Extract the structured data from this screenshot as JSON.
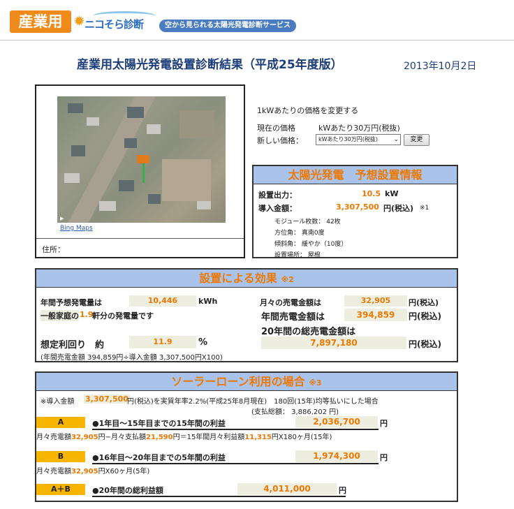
{
  "header": {
    "badge": "産業用",
    "brand_name": "ニコそら診断",
    "tagline": "空から見られる太陽光発電診断サービス"
  },
  "page": {
    "title": "産業用太陽光発電設置診断結果（平成25年度版）",
    "date": "2013年10月2日"
  },
  "map": {
    "bing_link": "Bing Maps",
    "address_label": "住所："
  },
  "price_change": {
    "heading": "1kWあたりの価格を変更する",
    "current_label": "現在の価格",
    "current_value": "kWあたり30万円(税抜)",
    "new_label": "新しい価格：",
    "select_value": "kWあたり30万円(税抜)",
    "button_label": "変更"
  },
  "install": {
    "title": "太陽光発電　予想設置情報",
    "output_label": "設置出力：",
    "output_value": "10.5",
    "output_unit": "kW",
    "cost_label": "導入金額：",
    "cost_value": "3,307,500",
    "cost_unit": "円(税込)",
    "cost_note": "※1",
    "modules": "モジュール枚数： 42枚",
    "direction": "方位角： 真南0度",
    "tilt": "傾斜角： 緩やか（10度）",
    "location": "設置場所： 屋根"
  },
  "effect": {
    "title": "設置による効果",
    "note": "※2",
    "annual_gen_label": "年間予想発電量は",
    "annual_gen_value": "10,446",
    "annual_gen_unit": "kWh",
    "household_pre": "一般家庭の",
    "household_value": "1.9",
    "household_post": "軒分の発電量です",
    "yield_label": "想定利回り　約",
    "yield_value": "11.9",
    "yield_unit": "%",
    "yield_formula": "(年間売電金額 394,859円÷導入金額 3,307,500円X100)",
    "monthly_sale_label": "月々の売電金額は",
    "monthly_sale_value": "32,905",
    "monthly_sale_unit": "円(税込)",
    "annual_sale_label": "年間売電金額は",
    "annual_sale_value": "394,859",
    "annual_sale_unit": "円(税込)",
    "total20_label": "20年間の総売電金額は",
    "total20_value": "7,897,180",
    "total20_unit": "円(税込)"
  },
  "loan": {
    "title": "ソーラーローン利用の場合",
    "note": "※3",
    "desc_pre": "※導入金額",
    "desc_amount": "3,307,500",
    "desc_post": "円(税込)を実質年率2.2%(平成25年8月現在)　180回(15年)均等払いにした場合",
    "total_payment": "(支払総額： 3,886,202 円)",
    "a_tag": "A",
    "a_label": "●1年目〜15年目までの15年間の利益",
    "a_value": "2,036,700",
    "a_unit": "円",
    "a_f1": "月々売電額",
    "a_f2": "32,905",
    "a_f3": "円−月々支払額",
    "a_f4": "21,590",
    "a_f5": "円＝15年間月々利益額",
    "a_f6": "11,315",
    "a_f7": "円X180ヶ月(15年)",
    "b_tag": "B",
    "b_label": "●16年目〜20年目までの5年間の利益",
    "b_value": "1,974,300",
    "b_unit": "円",
    "b_f1": "月々売電額",
    "b_f2": "32,905",
    "b_f3": "円X60ヶ月(5年)",
    "ab_tag": "A＋B",
    "ab_label": "●20年間の総利益額",
    "ab_value": "4,011,000",
    "ab_unit": "円"
  }
}
